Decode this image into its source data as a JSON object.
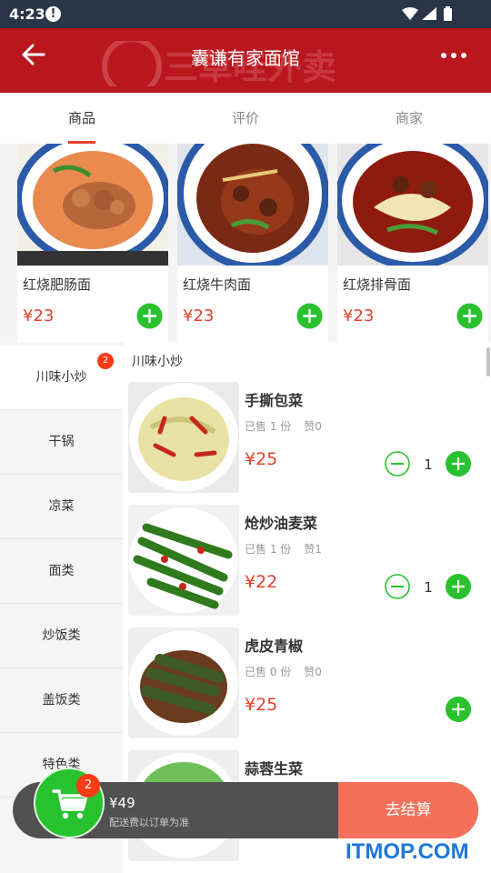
{
  "status": {
    "time": "4:23",
    "alert_glyph": "!"
  },
  "header": {
    "title": "囊谦有家面馆",
    "watermark": "三草哇外卖"
  },
  "tabs": [
    {
      "label": "商品",
      "active": true
    },
    {
      "label": "评价",
      "active": false
    },
    {
      "label": "商家",
      "active": false
    }
  ],
  "featured": [
    {
      "name": "红烧肥肠面",
      "price": "¥23"
    },
    {
      "name": "红烧牛肉面",
      "price": "¥23"
    },
    {
      "name": "红烧排骨面",
      "price": "¥23"
    }
  ],
  "categories": [
    {
      "label": "川味小炒",
      "badge": "2",
      "active": true
    },
    {
      "label": "干锅"
    },
    {
      "label": "凉菜"
    },
    {
      "label": "面类"
    },
    {
      "label": "炒饭类"
    },
    {
      "label": "盖饭类"
    },
    {
      "label": "特色类"
    }
  ],
  "section_title": "川味小炒",
  "items": [
    {
      "name": "手撕包菜",
      "sold": "已售 1 份",
      "likes": "赞0",
      "price": "¥25",
      "qty": "1"
    },
    {
      "name": "炝炒油麦菜",
      "sold": "已售 1 份",
      "likes": "赞1",
      "price": "¥22",
      "qty": "1"
    },
    {
      "name": "虎皮青椒",
      "sold": "已售 0 份",
      "likes": "赞0",
      "price": "¥25",
      "qty": ""
    },
    {
      "name": "蒜蓉生菜"
    }
  ],
  "cart": {
    "count": "2",
    "total": "¥49",
    "fee_note": "配送费以订单为准",
    "checkout_label": "去结算"
  },
  "site_watermark": "ITMOP.COM",
  "colors": {
    "header_red": "#b9161e",
    "price_red": "#e5412b",
    "add_green": "#27c22e",
    "checkout": "#f4705b"
  }
}
